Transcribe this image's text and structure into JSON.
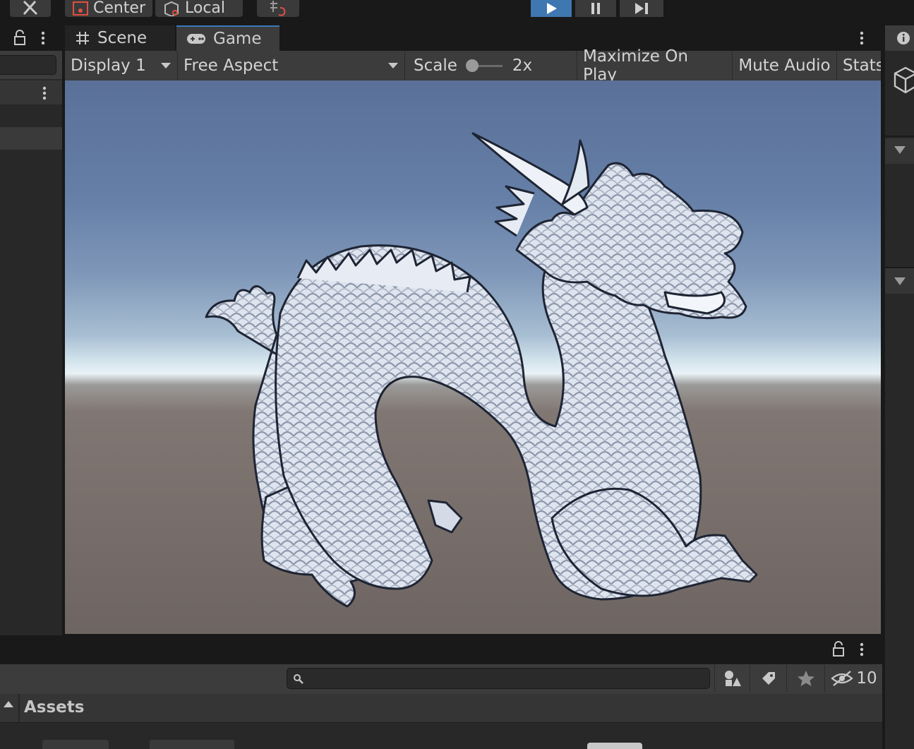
{
  "toolbar": {
    "center_label": "Center",
    "local_label": "Local"
  },
  "tabs": {
    "scene_label": "Scene",
    "game_label": "Game"
  },
  "game_toolbar": {
    "display": "Display 1",
    "aspect": "Free Aspect",
    "scale_label": "Scale",
    "scale_value": "2x",
    "scale_slider_fraction": 0,
    "maximize_label": "Maximize On Play",
    "mute_label": "Mute Audio",
    "stats_label": "Stats"
  },
  "project": {
    "hidden_count": "10",
    "search_placeholder": "",
    "breadcrumb": "Assets"
  },
  "colors": {
    "accent": "#3a79bb",
    "panel": "#282828",
    "toolbar": "#3c3c3c",
    "dragon": "#e3e8f1"
  },
  "icons": [
    "tool-icon",
    "center-pivot-icon",
    "local-icon",
    "snap-icon",
    "play-icon",
    "pause-icon",
    "step-icon",
    "lock-icon",
    "kebab-icon",
    "grid-icon",
    "gamepad-icon",
    "dropdown-arrow-icon",
    "info-icon",
    "cube-icon",
    "collapse-arrow-icon",
    "search-icon",
    "type-filter-icon",
    "label-icon",
    "star-icon",
    "hidden-eye-icon"
  ]
}
